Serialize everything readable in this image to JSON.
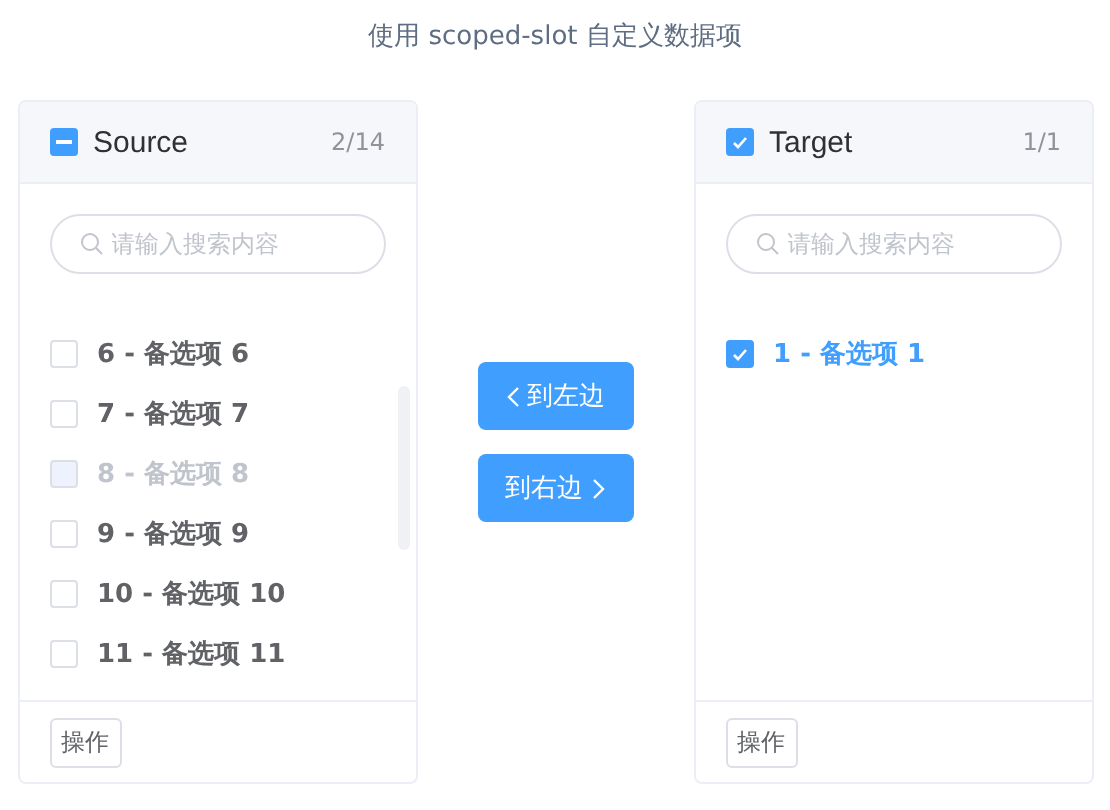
{
  "title": "使用 scoped-slot 自定义数据项",
  "panels": [
    {
      "title": "Source",
      "checked": false,
      "indeterminate": true,
      "count": "2/14",
      "search": {
        "placeholder": "请输入搜索内容"
      },
      "items": [
        {
          "label": "6 - 备选项 6",
          "checked": false,
          "disabled": false
        },
        {
          "label": "7 - 备选项 7",
          "checked": false,
          "disabled": false
        },
        {
          "label": "8 - 备选项 8",
          "checked": false,
          "disabled": true
        },
        {
          "label": "9 - 备选项 9",
          "checked": false,
          "disabled": false
        },
        {
          "label": "10 - 备选项 10",
          "checked": false,
          "disabled": false
        },
        {
          "label": "11 - 备选项 11",
          "checked": false,
          "disabled": false
        }
      ],
      "footer_button": "操作"
    },
    {
      "title": "Target",
      "checked": true,
      "indeterminate": false,
      "count": "1/1",
      "search": {
        "placeholder": "请输入搜索内容"
      },
      "items": [
        {
          "label": "1 - 备选项 1",
          "checked": true,
          "disabled": false
        }
      ],
      "footer_button": "操作"
    }
  ],
  "buttons": [
    {
      "label": "到左边",
      "kind": "left"
    },
    {
      "label": "到右边",
      "kind": "right"
    }
  ]
}
